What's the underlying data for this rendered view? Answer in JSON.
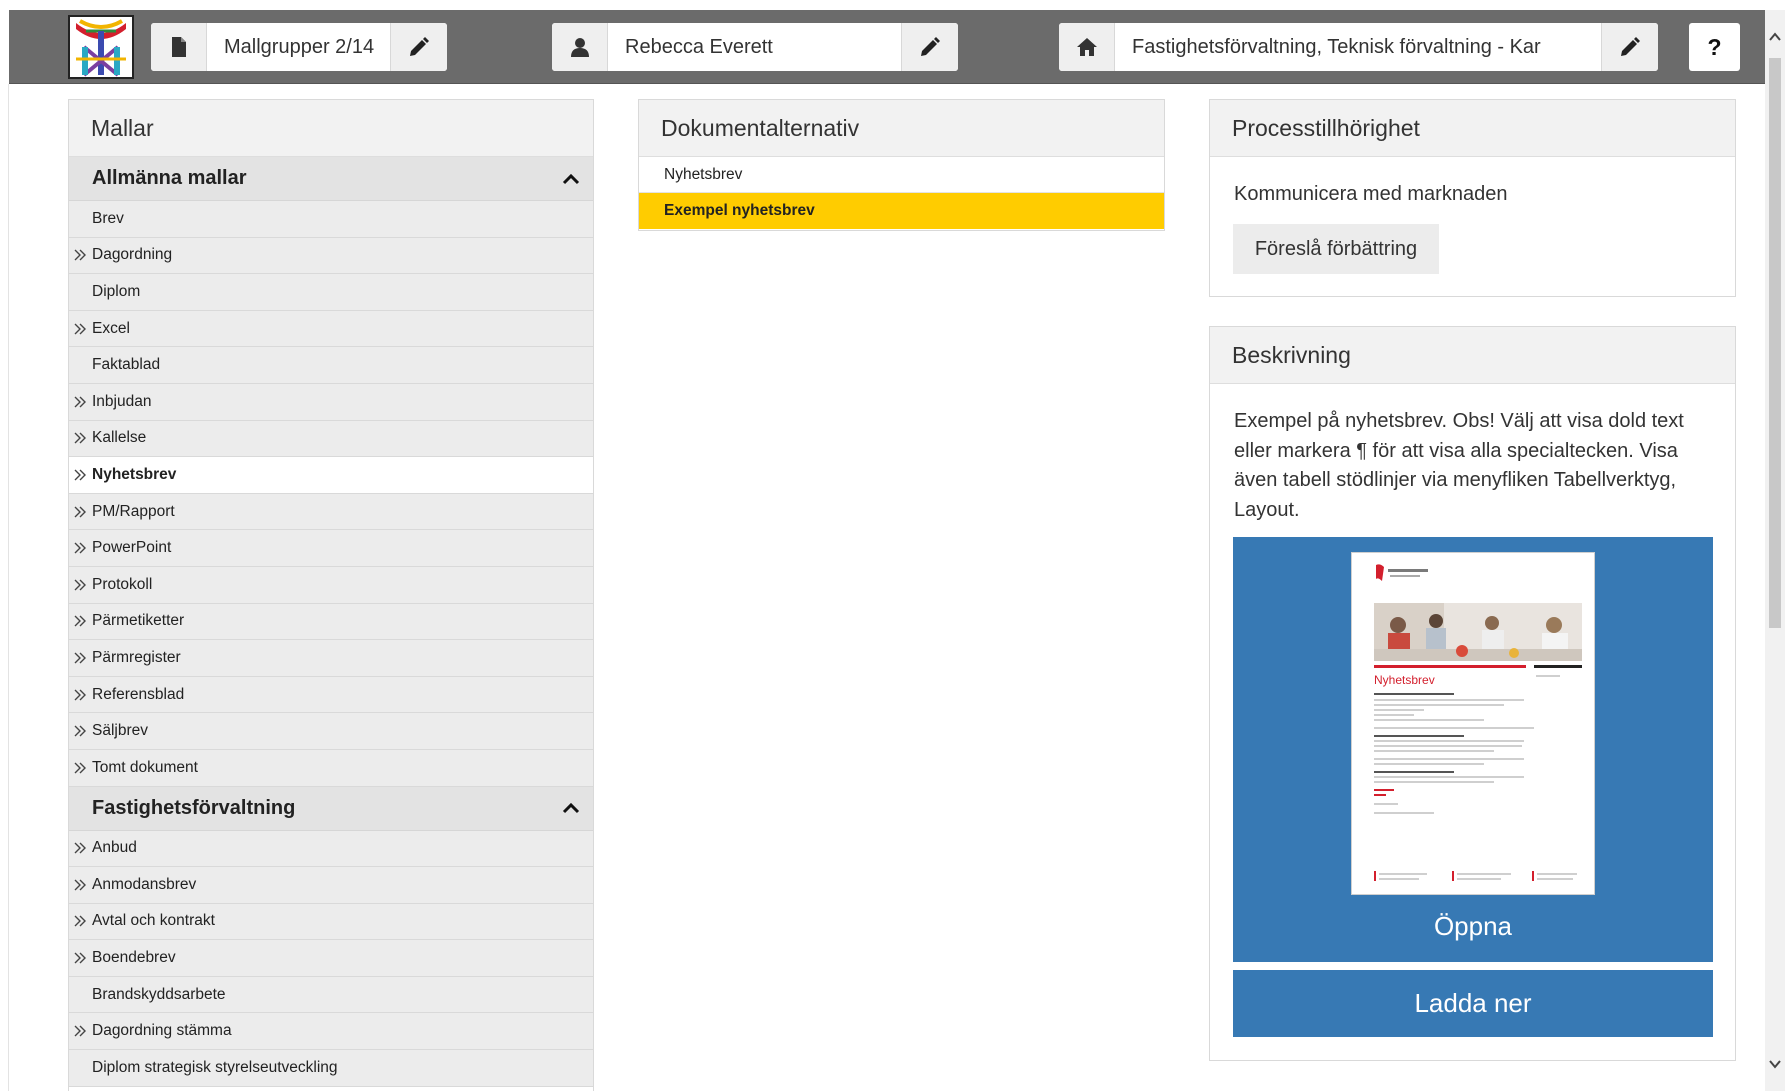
{
  "topbar": {
    "template_group": "Mallgrupper 2/14",
    "user": "Rebecca Everett",
    "org": "Fastighetsförvaltning, Teknisk förvaltning - Kar",
    "help": "?"
  },
  "templates": {
    "title": "Mallar",
    "groups": [
      {
        "name": "Allmänna mallar",
        "items": [
          {
            "label": "Brev",
            "sub": false
          },
          {
            "label": "Dagordning",
            "sub": true
          },
          {
            "label": "Diplom",
            "sub": false
          },
          {
            "label": "Excel",
            "sub": true
          },
          {
            "label": "Faktablad",
            "sub": false
          },
          {
            "label": "Inbjudan",
            "sub": true
          },
          {
            "label": "Kallelse",
            "sub": true
          },
          {
            "label": "Nyhetsbrev",
            "sub": true,
            "active": true
          },
          {
            "label": "PM/Rapport",
            "sub": true
          },
          {
            "label": "PowerPoint",
            "sub": true
          },
          {
            "label": "Protokoll",
            "sub": true
          },
          {
            "label": "Pärmetiketter",
            "sub": true
          },
          {
            "label": "Pärmregister",
            "sub": true
          },
          {
            "label": "Referensblad",
            "sub": true
          },
          {
            "label": "Säljbrev",
            "sub": true
          },
          {
            "label": "Tomt dokument",
            "sub": true
          }
        ]
      },
      {
        "name": "Fastighetsförvaltning",
        "items": [
          {
            "label": "Anbud",
            "sub": true
          },
          {
            "label": "Anmodansbrev",
            "sub": true
          },
          {
            "label": "Avtal och kontrakt",
            "sub": true
          },
          {
            "label": "Boendebrev",
            "sub": true
          },
          {
            "label": "Brandskyddsarbete",
            "sub": false
          },
          {
            "label": "Dagordning stämma",
            "sub": true
          },
          {
            "label": "Diplom strategisk styrelseutveckling",
            "sub": false
          }
        ]
      }
    ]
  },
  "documents": {
    "title": "Dokumentalternativ",
    "items": [
      {
        "label": "Nyhetsbrev",
        "selected": false
      },
      {
        "label": "Exempel nyhetsbrev",
        "selected": true
      }
    ]
  },
  "process": {
    "title": "Processtillhörighet",
    "text": "Kommunicera med marknaden",
    "suggest_label": "Föreslå förbättring"
  },
  "description": {
    "title": "Beskrivning",
    "text": "Exempel på nyhetsbrev. Obs! Välj att visa dold text eller markera ¶ för att visa alla specialtecken. Visa även tabell stödlinjer via menyfliken Tabellverktyg, Layout.",
    "preview_heading": "Nyhetsbrev",
    "open_label": "Öppna",
    "download_label": "Ladda ner"
  },
  "colors": {
    "topbar": "#6b6b6b",
    "selected": "#ffcc00",
    "action_blue": "#3779b4",
    "brand_red": "#d31f2d"
  },
  "icons": {
    "template_group": "document-icon",
    "user": "user-icon",
    "org": "home-icon",
    "edit": "pencil-icon",
    "collapse": "chevron-up-icon",
    "subitems": "double-chevron-right-icon"
  }
}
